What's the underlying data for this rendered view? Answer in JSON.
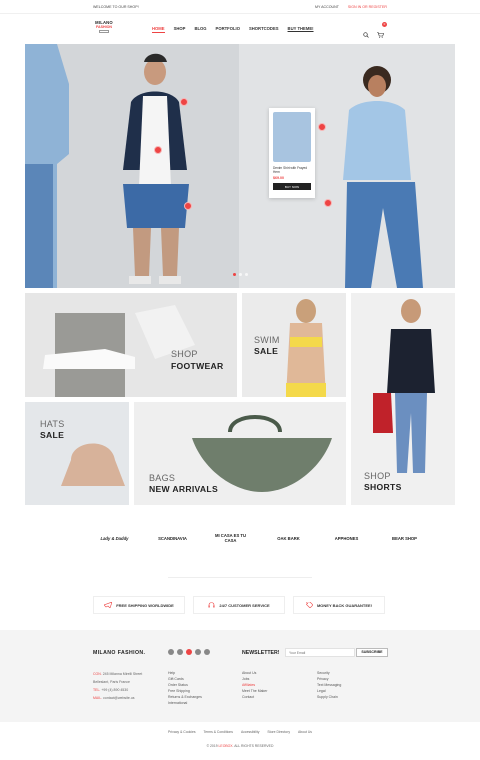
{
  "topbar": {
    "welcome": "WELCOME TO OUR SHOP!",
    "account": "MY ACCOUNT",
    "signin": "SIGN IN OR REGISTER"
  },
  "logo": {
    "line1": "MILANO",
    "line2": "FASHION"
  },
  "nav": {
    "items": [
      "HOME",
      "SHOP",
      "BLOG",
      "PORTFOLIO",
      "SHORTCODES",
      "BUY THEME!"
    ]
  },
  "cart": {
    "count": "0"
  },
  "hero": {
    "card": {
      "name": "Denim Shirt with Frayed Hem",
      "price": "$69.00",
      "button": "BUY NOW"
    }
  },
  "banners": {
    "footwear": {
      "t1": "SHOP",
      "t2": "FOOTWEAR"
    },
    "swim": {
      "t1": "SWIM",
      "t2": "SALE"
    },
    "hats": {
      "t1": "HATS",
      "t2": "SALE"
    },
    "bags": {
      "t1": "BAGS",
      "t2": "NEW ARRIVALS"
    },
    "shorts": {
      "t1": "SHOP",
      "t2": "SHORTS"
    }
  },
  "brands": [
    "Lady & Daddy",
    "SCANDINAVIA",
    "MI CASA ES TU CASA",
    "OAK BARK",
    "APPHONES",
    "BEAR SHOP"
  ],
  "features": [
    {
      "label": "FREE SHIPPING WORLDWIDE",
      "icon": "plane-icon"
    },
    {
      "label": "24/7 CUSTOMER SERVICE",
      "icon": "headset-icon"
    },
    {
      "label": "MONEY BACK GUARANTEE!",
      "icon": "tag-icon"
    }
  ],
  "footer": {
    "brand": "MILANO FASHION.",
    "newsletter": "NEWSLETTER!",
    "email_placeholder": "Your Email",
    "subscribe": "SUBSCRIBE",
    "address": {
      "lbl1": "CON.",
      "v1": "245 Milanna Mirelli Street",
      "v2": "Belleslant, Paris France",
      "lbl2": "TEL.",
      "v3": "+99 (4) 890 4530",
      "lbl3": "MAIL.",
      "v4": "contact@website.us"
    },
    "col1": [
      "Help",
      "Gift Cards",
      "Order Status",
      "Free Shipping",
      "Returns & Exchanges",
      "International"
    ],
    "col2": [
      "About Us",
      "Jobs",
      "Affiliates",
      "Meet The Maker",
      "Contact"
    ],
    "col3": [
      "Security",
      "Privacy",
      "Text Messaging",
      "Legal",
      "Supply Chain"
    ],
    "links": [
      "Privacy & Cookies",
      "Terms & Conditions",
      "Accessibility",
      "Store Directory",
      "About Us"
    ],
    "copy_a": "© 2019",
    "copy_b": "LEOBOX",
    "copy_c": ". ALL RIGHTS RESERVED"
  }
}
